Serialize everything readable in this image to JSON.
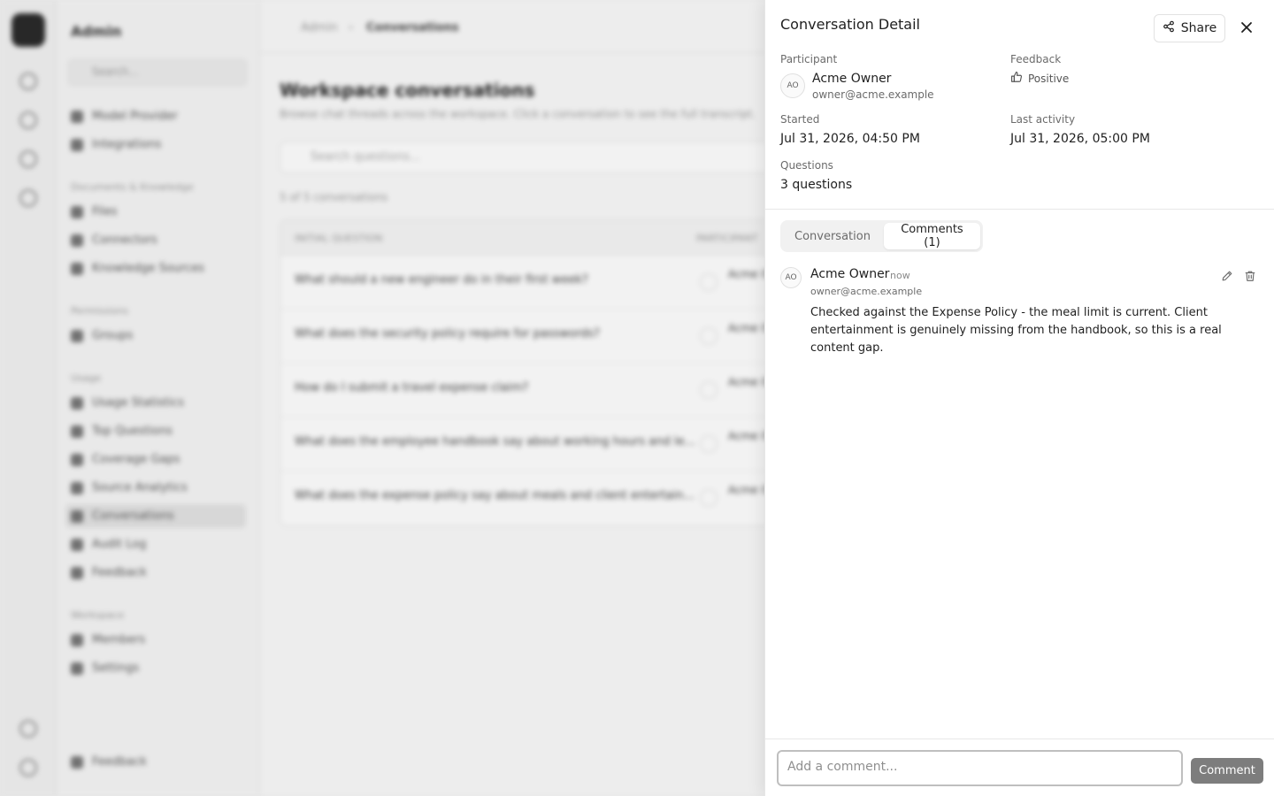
{
  "background": {
    "sidebar": {
      "title": "Admin",
      "search_placeholder": "Search...",
      "items_top": [
        "Model Provider",
        "Integrations"
      ],
      "section_documents": "Documents & Knowledge",
      "items_documents": [
        "Files",
        "Connectors",
        "Knowledge Sources"
      ],
      "section_permissions": "Permissions",
      "items_permissions": [
        "Groups"
      ],
      "section_usage": "Usage",
      "items_usage": [
        "Usage Statistics",
        "Top Questions",
        "Coverage Gaps",
        "Source Analytics",
        "Conversations",
        "Audit Log",
        "Feedback"
      ],
      "section_workspace": "Workspace",
      "items_workspace": [
        "Members",
        "Settings"
      ],
      "footer_item": "Feedback"
    },
    "breadcrumb": [
      "Admin",
      "Conversations"
    ],
    "page_title": "Workspace conversations",
    "page_subtitle": "Browse chat threads across the workspace. Click a conversation to see the full transcript.",
    "search_placeholder": "Search questions...",
    "count_text": "5 of 5 conversations",
    "table_headers": [
      "INITIAL QUESTION",
      "PARTICIPANT"
    ],
    "rows": [
      "What should a new engineer do in their first week?",
      "What does the security policy require for passwords?",
      "How do I submit a travel expense claim?",
      "What does the employee handbook say about working hours and le...",
      "What does the expense policy say about meals and client entertain..."
    ],
    "row_participant": "Acme Owner"
  },
  "drawer": {
    "title": "Conversation Detail",
    "share_label": "Share",
    "participant_label": "Participant",
    "participant_initials": "AO",
    "participant_name": "Acme Owner",
    "participant_email": "owner@acme.example",
    "feedback_label": "Feedback",
    "feedback_value": "Positive",
    "started_label": "Started",
    "started_value": "Jul 31, 2026, 04:50 PM",
    "last_activity_label": "Last activity",
    "last_activity_value": "Jul 31, 2026, 05:00 PM",
    "questions_label": "Questions",
    "questions_value": "3 questions",
    "tabs": [
      {
        "label": "Conversation",
        "active": false
      },
      {
        "label": "Comments (1)",
        "active": true
      }
    ],
    "comment": {
      "initials": "AO",
      "author": "Acme Owner",
      "time": "now",
      "email": "owner@acme.example",
      "body": "Checked against the Expense Policy - the meal limit is current. Client entertainment is genuinely missing from the handbook, so this is a real content gap."
    },
    "comment_placeholder": "Add a comment...",
    "comment_button": "Comment"
  }
}
